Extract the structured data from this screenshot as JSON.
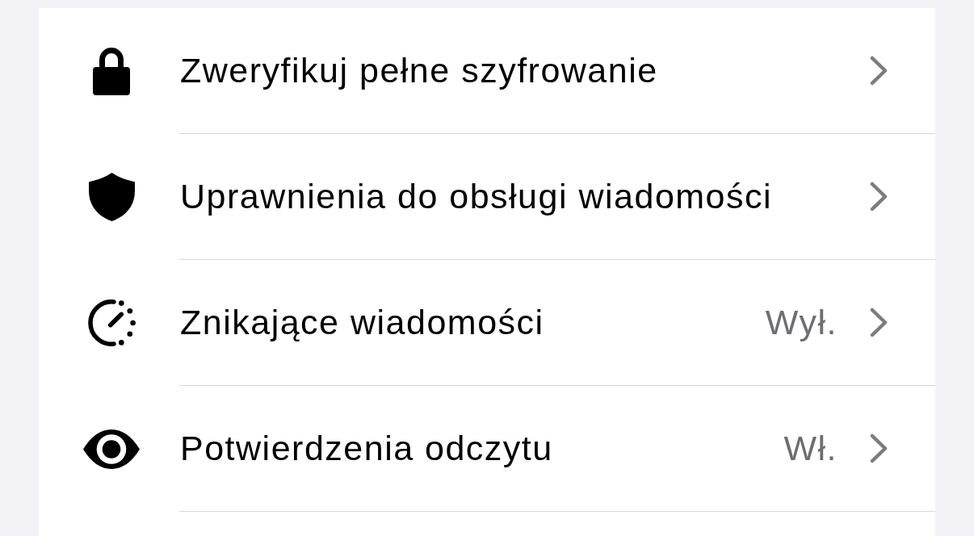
{
  "rows": [
    {
      "label": "Zweryfikuj pełne szyfrowanie"
    },
    {
      "label": "Uprawnienia do obsługi wiadomości"
    },
    {
      "label": "Znikające wiadomości",
      "value": "Wył."
    },
    {
      "label": "Potwierdzenia odczytu",
      "value": "Wł."
    }
  ]
}
